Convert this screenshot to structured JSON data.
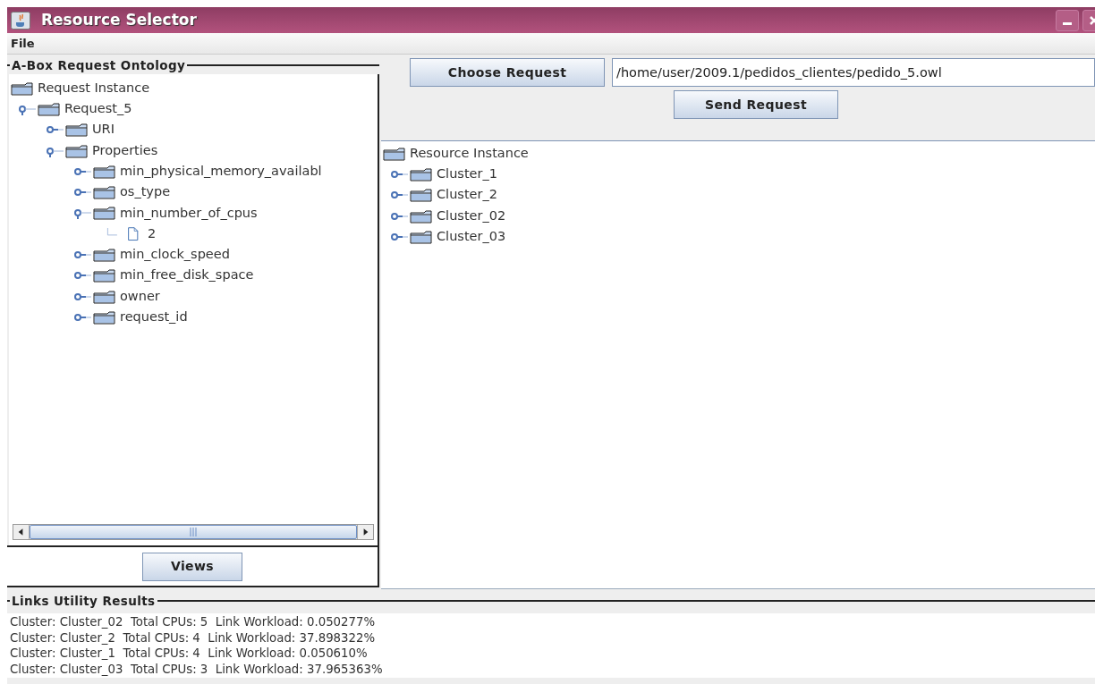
{
  "window": {
    "title": "Resource Selector"
  },
  "menu": [
    "File"
  ],
  "request_panel": {
    "title": "A-Box Request Ontology",
    "tree": [
      {
        "label": "Request Instance",
        "kind": "folder",
        "children": [
          {
            "label": "Request_5",
            "kind": "folder",
            "expanded": true,
            "children": [
              {
                "label": "URI",
                "kind": "folder",
                "expanded": false
              },
              {
                "label": "Properties",
                "kind": "folder",
                "expanded": true,
                "children": [
                  {
                    "label": "min_physical_memory_availabl",
                    "kind": "folder",
                    "expanded": false
                  },
                  {
                    "label": "os_type",
                    "kind": "folder",
                    "expanded": false
                  },
                  {
                    "label": "min_number_of_cpus",
                    "kind": "folder",
                    "expanded": true,
                    "children": [
                      {
                        "label": "2",
                        "kind": "file"
                      }
                    ]
                  },
                  {
                    "label": "min_clock_speed",
                    "kind": "folder",
                    "expanded": false
                  },
                  {
                    "label": "min_free_disk_space",
                    "kind": "folder",
                    "expanded": false
                  },
                  {
                    "label": "owner",
                    "kind": "folder",
                    "expanded": false
                  },
                  {
                    "label": "request_id",
                    "kind": "folder",
                    "expanded": false
                  }
                ]
              }
            ]
          }
        ]
      }
    ],
    "button": "Views"
  },
  "request_bar": {
    "choose_button": "Choose Request",
    "path_field": "/home/user/2009.1/pedidos_clientes/pedido_5.owl",
    "send_button": "Send Request"
  },
  "resource_tree": [
    {
      "label": "Resource Instance",
      "kind": "folder",
      "children": [
        {
          "label": "Cluster_1",
          "kind": "folder",
          "expanded": false
        },
        {
          "label": "Cluster_2",
          "kind": "folder",
          "expanded": false
        },
        {
          "label": "Cluster_02",
          "kind": "folder",
          "expanded": false
        },
        {
          "label": "Cluster_03",
          "kind": "folder",
          "expanded": false
        }
      ]
    }
  ],
  "results": {
    "title": "Links Utility Results",
    "lines": [
      "Cluster: Cluster_02  Total CPUs: 5  Link Workload: 0.050277%",
      "Cluster: Cluster_2  Total CPUs: 4  Link Workload: 37.898322%",
      "Cluster: Cluster_1  Total CPUs: 4  Link Workload: 0.050610%",
      "Cluster: Cluster_03  Total CPUs: 3  Link Workload: 37.965363%"
    ]
  }
}
